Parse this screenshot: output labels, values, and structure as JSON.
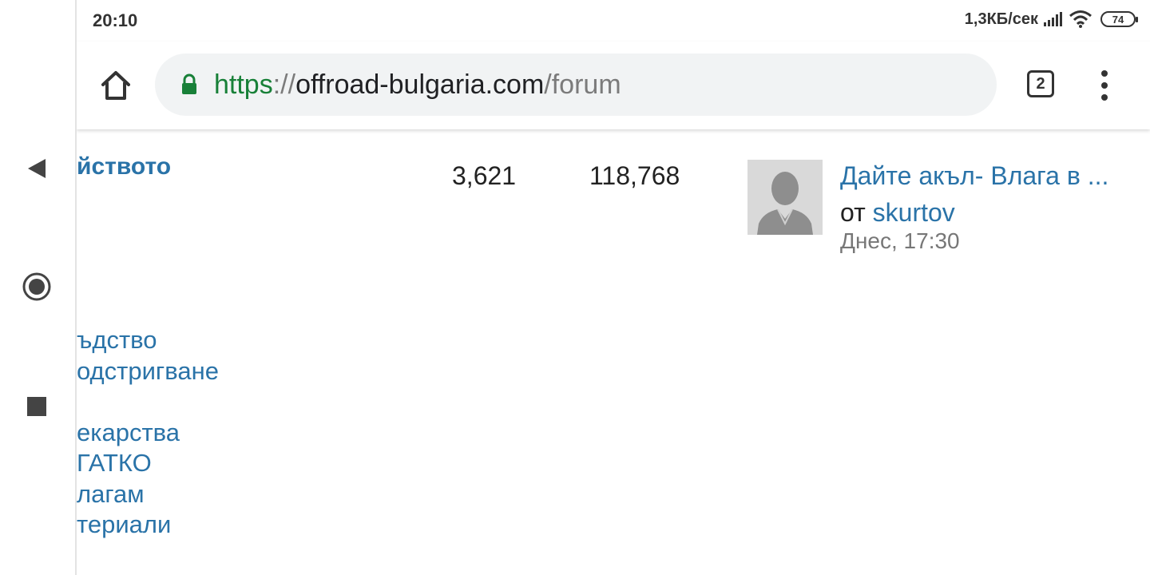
{
  "status_bar": {
    "time": "20:10",
    "net_speed": "1,3КБ/сек",
    "battery": "74",
    "icons": [
      "signal-icon",
      "wifi-icon",
      "battery-icon"
    ]
  },
  "browser": {
    "url_scheme": "https",
    "url_sep": "://",
    "url_host": "offroad-bulgaria.com",
    "url_path": "/forum",
    "tab_count": "2",
    "secure_color": "#188038"
  },
  "forum_row": {
    "title": "йството",
    "topics": "3,621",
    "posts": "118,768",
    "last_post": {
      "title": "Дайте акъл- Влага в ...",
      "by_prefix": "от ",
      "author": "skurtov",
      "date": "Днес, 17:30"
    }
  },
  "subforums": [
    "ъдство",
    "одстригване",
    "екарства",
    "ГАТКО",
    "лагам",
    "териали"
  ],
  "colors": {
    "link": "#2a73a8",
    "text": "#222222",
    "muted": "#777777"
  }
}
